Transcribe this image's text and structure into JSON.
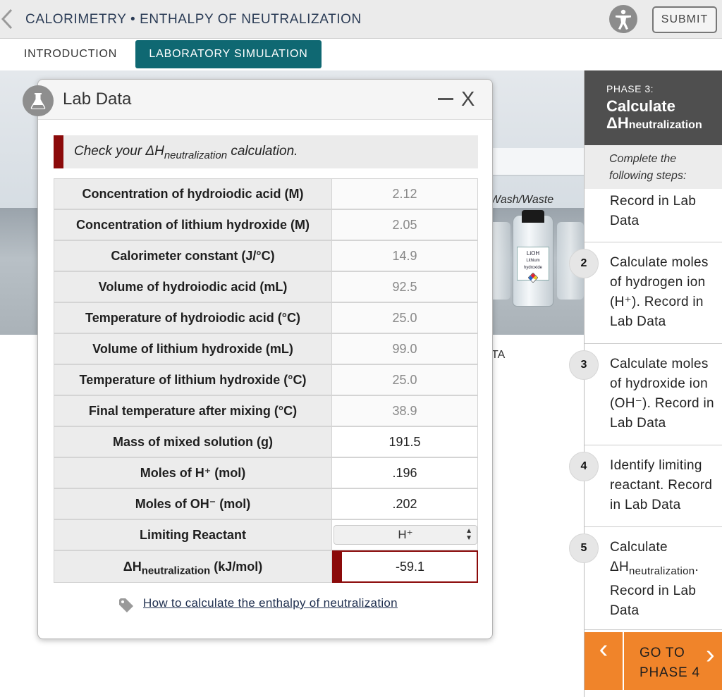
{
  "header": {
    "title": "CALORIMETRY • ENTHALPY OF NEUTRALIZATION",
    "submit_label": "SUBMIT",
    "back_icon": "chevron-left-icon",
    "accessibility_icon": "accessibility-icon"
  },
  "tabs": [
    {
      "label": "INTRODUCTION",
      "active": false
    },
    {
      "label": "LABORATORY SIMULATION",
      "active": true
    }
  ],
  "scene": {
    "wash_label": "Wash/Waste",
    "bottle_label_1": "LiOH",
    "bottle_label_2": "Lithium hydroxide",
    "partial_text": "TA"
  },
  "modal": {
    "title": "Lab Data",
    "notice_prefix": "Check your ΔH",
    "notice_sub": "neutralization",
    "notice_suffix": " calculation.",
    "rows": [
      {
        "label": "Concentration of hydroiodic acid (M)",
        "value": "2.12"
      },
      {
        "label": "Concentration of lithium hydroxide (M)",
        "value": "2.05"
      },
      {
        "label": "Calorimeter constant (J/°C)",
        "value": "14.9"
      },
      {
        "label": "Volume of hydroiodic acid (mL)",
        "value": "92.5"
      },
      {
        "label": "Temperature of hydroiodic acid (°C)",
        "value": "25.0"
      },
      {
        "label": "Volume of lithium hydroxide (mL)",
        "value": "99.0"
      },
      {
        "label": "Temperature of lithium hydroxide (°C)",
        "value": "25.0"
      },
      {
        "label": "Final temperature after mixing (°C)",
        "value": "38.9"
      },
      {
        "label": "Mass of mixed solution (g)",
        "value": "191.5"
      },
      {
        "label": "Moles of H⁺ (mol)",
        "value": ".196"
      },
      {
        "label": "Moles of OH⁻ (mol)",
        "value": ".202"
      },
      {
        "label": "Limiting Reactant",
        "value": "H⁺"
      },
      {
        "label_prefix": "ΔH",
        "label_sub": "neutralization",
        "label_suffix": " (kJ/mol)",
        "value": "-59.1"
      }
    ],
    "help_link": "How to calculate the enthalpy of neutralization"
  },
  "panel": {
    "phase_label": "PHASE 3:",
    "phase_title": "Calculate",
    "phase_dh": "ΔH",
    "phase_sub": "neutralization",
    "steps_intro": "Complete the following steps:",
    "step1_text": "Record in Lab Data",
    "steps": [
      {
        "num": "2",
        "text": "Calculate moles of hydrogen ion (H⁺). Record in Lab Data"
      },
      {
        "num": "3",
        "text": "Calculate moles of hydroxide ion (OH⁻). Record in Lab Data"
      },
      {
        "num": "4",
        "text": "Identify limiting reactant. Record in Lab Data"
      },
      {
        "num": "5",
        "text_prefix": "Calculate ΔH",
        "text_sub": "neutralization",
        "text_suffix": ". Record in Lab Data"
      }
    ],
    "go_label": "GO TO PHASE 4"
  },
  "colors": {
    "teal_tab": "#0f6872",
    "error_red": "#8b0a0a",
    "orange_button": "#f0842a",
    "phase_header": "#4f4f4f"
  }
}
